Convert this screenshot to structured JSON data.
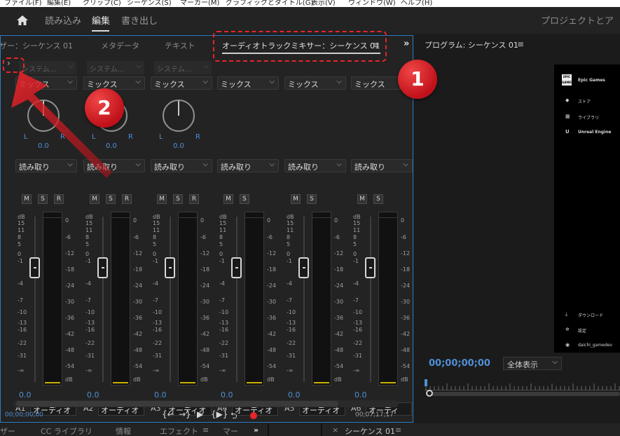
{
  "menubar": {
    "items": [
      "ファイル(F)",
      "編集(E)",
      "クリップ(C)",
      "シーケンス(S)",
      "マーカー(M)",
      "グラフィックとタイトル(G)",
      "表示(V)",
      "ウィンドウ(W)",
      "ヘルプ(H)"
    ]
  },
  "workspaces": {
    "items": [
      "読み込み",
      "編集",
      "書き出し"
    ],
    "active": "編集",
    "right": "プロジェクトとア"
  },
  "mixer": {
    "tabs": [
      "ザー：シーケンス 01",
      "メタデータ",
      "テキスト",
      "オーディオトラックミキサー：シーケンス 01"
    ],
    "tab_menu": "≡",
    "tab_more": "»",
    "expand_arrow": "›",
    "left_scale": [
      "dB",
      "15",
      "11",
      "8",
      "5",
      "0",
      "-1",
      "-4",
      "-7",
      "-10",
      "-13",
      "-16",
      "-22",
      "-31",
      "-∞"
    ],
    "meter_scale": [
      "0",
      "-6",
      "-12",
      "-18",
      "-24",
      "-30",
      "-36",
      "-42",
      "-48",
      "-54",
      "dB"
    ],
    "strips": [
      {
        "system": "システム...",
        "mix": "ミックス",
        "pan": "0.0",
        "L": "L",
        "R": "R",
        "mode": "読み取り",
        "buttons": [
          "M",
          "S",
          "R"
        ],
        "vol": "0.0",
        "track": "A1",
        "name": "オーディオ"
      },
      {
        "system": "システム...",
        "mix": "ミックス",
        "pan": "0.0",
        "L": "L",
        "R": "R",
        "mode": "読み取り",
        "buttons": [
          "M",
          "S",
          "R"
        ],
        "vol": "0.0",
        "track": "A2",
        "name": "オーディオ"
      },
      {
        "system": "システム...",
        "mix": "ミックス",
        "pan": "0.0",
        "L": "L",
        "R": "R",
        "mode": "読み取り",
        "buttons": [
          "M",
          "S",
          "R"
        ],
        "vol": "0.0",
        "track": "A3",
        "name": "オーディオ"
      },
      {
        "system": "",
        "mix": "ミックス",
        "pan": "",
        "L": "",
        "R": "",
        "mode": "読み取り",
        "buttons": [
          "M",
          "S"
        ],
        "vol": "0.0",
        "track": "A4",
        "name": "オーディオ"
      },
      {
        "system": "",
        "mix": "ミックス",
        "pan": "",
        "L": "",
        "R": "",
        "mode": "読み取り",
        "buttons": [
          "M",
          "S"
        ],
        "vol": "0.0",
        "track": "A5",
        "name": "オーディオ"
      },
      {
        "system": "",
        "mix": "ミックス",
        "pan": "",
        "L": "",
        "R": "",
        "mode": "読み取り",
        "buttons": [
          "M",
          "S"
        ],
        "vol": "0.0",
        "track": "A6",
        "name": "オーディ"
      }
    ],
    "timecode_left": "00;00;00;00",
    "timecode_right": "00;07;17;17",
    "transport": [
      "{←",
      "→}",
      "▶",
      "{▶}",
      "⮌"
    ]
  },
  "program": {
    "title": "プログラム: シーケンス 01",
    "menu": "≡",
    "timecode": "00;00;00;00",
    "zoom": "全体表示",
    "video": {
      "logo": "EPIC GAMES",
      "brand": "Epic Games",
      "nav": [
        "ストア",
        "ライブラリ",
        "Unreal Engine"
      ],
      "bottom": [
        "ダウンロード",
        "設定",
        "daichi_gamedev"
      ]
    }
  },
  "bottom": {
    "tabs": [
      "ザー",
      "CC ライブラリ",
      "情報",
      "エフェクト",
      "≡",
      "マー",
      "»",
      "×",
      "シーケンス 01",
      "≡"
    ]
  },
  "annotations": {
    "badge1": "1",
    "badge2": "2",
    "accent": "#e8242a"
  }
}
